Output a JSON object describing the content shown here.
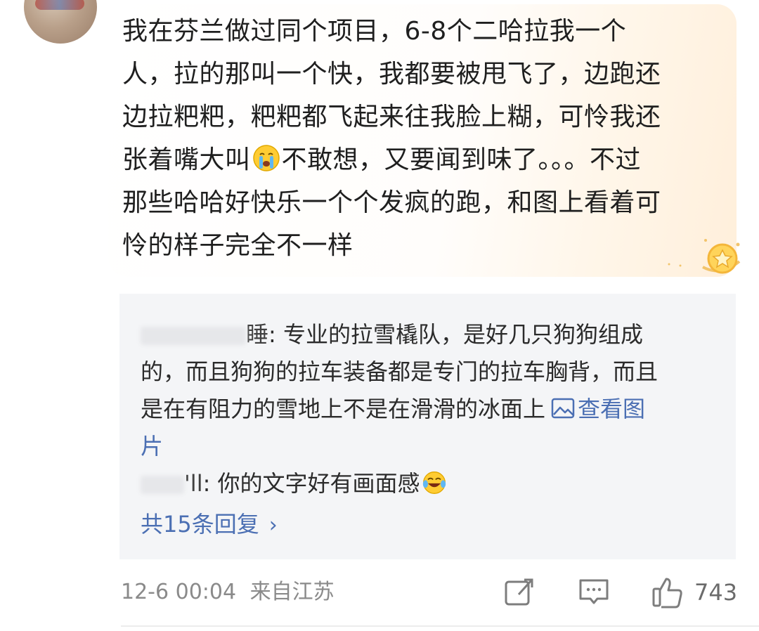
{
  "comment": {
    "line1": "我在芬兰做过同个项目，6-8个二哈拉我一个",
    "line2": "人，拉的那叫一个快，我都要被甩飞了，边跑还",
    "line3": "边拉粑粑，粑粑都飞起来往我脸上糊，可怜我还",
    "line4_a": "张着嘴大叫",
    "line4_emoji": "crying-face",
    "line4_b": "不敢想，又要闻到味了。。。不过",
    "line5": "那些哈哈好快乐一个个发疯的跑，和图上看着可",
    "line6": "怜的样子完全不一样"
  },
  "replies": {
    "reply1": {
      "name_tail": "睡",
      "text_first": ": 专业的拉雪橇队，是好几只狗狗组成",
      "text_line2": "的，而且狗狗的拉车装备都是专门的拉车胸背，而且",
      "text_line3": "是在有阻力的雪地上不是在滑滑的冰面上",
      "link_label": "查看图",
      "link_tail": "片"
    },
    "reply2": {
      "name_tail": "'ll",
      "text": ": 你的文字好有画面感",
      "emoji": "laughing-crying-face"
    },
    "more_label": "共15条回复",
    "more_chevron": "›"
  },
  "meta": {
    "timestamp": "12-6 00:04",
    "location": "来自江苏",
    "like_count": "743"
  },
  "colors": {
    "link": "#4b6fb3",
    "text": "#1f1f1f",
    "meta": "#8a8a8a",
    "reply_bg": "#f4f5f7"
  }
}
